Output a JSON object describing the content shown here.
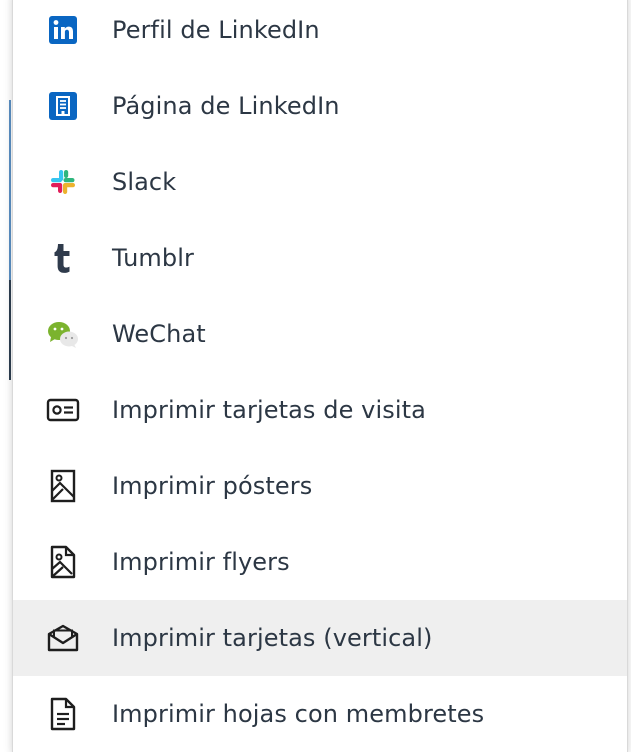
{
  "menu": {
    "items": [
      {
        "label": "Perfil de LinkedIn",
        "icon": "linkedin-icon",
        "color": "#0a66c2"
      },
      {
        "label": "Página de LinkedIn",
        "icon": "linkedin-page-icon",
        "color": "#0a66c2"
      },
      {
        "label": "Slack",
        "icon": "slack-icon"
      },
      {
        "label": "Tumblr",
        "icon": "tumblr-icon",
        "color": "#2f3b4c"
      },
      {
        "label": "WeChat",
        "icon": "wechat-icon",
        "color": "#7bb32e"
      },
      {
        "label": "Imprimir tarjetas de visita",
        "icon": "business-card-icon"
      },
      {
        "label": "Imprimir pósters",
        "icon": "poster-icon"
      },
      {
        "label": "Imprimir flyers",
        "icon": "flyer-icon"
      },
      {
        "label": "Imprimir tarjetas (vertical)",
        "icon": "envelope-card-icon",
        "highlighted": true
      },
      {
        "label": "Imprimir hojas con membretes",
        "icon": "letterhead-icon"
      }
    ]
  }
}
